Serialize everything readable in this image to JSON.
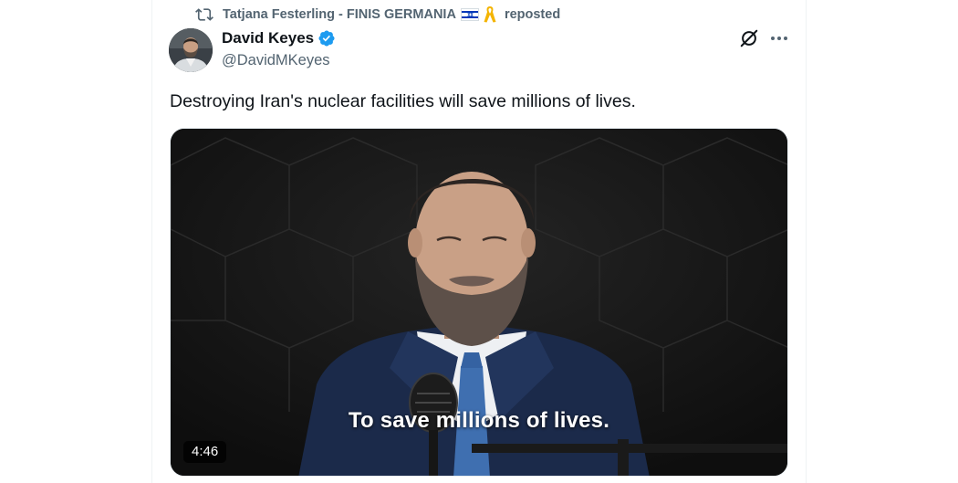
{
  "repost": {
    "reposter": "Tatjana Festerling - FINIS GERMANIA",
    "label": "reposted"
  },
  "author": {
    "name": "David Keyes",
    "handle": "@DavidMKeyes",
    "verified": true
  },
  "tweet": {
    "text": "Destroying Iran's nuclear facilities will save millions of lives."
  },
  "video": {
    "caption": "To save millions of lives.",
    "duration": "4:46"
  },
  "icons": {
    "repost": "repost-icon",
    "flag": "israel-flag-icon",
    "ribbon": "yellow-ribbon-icon",
    "verified": "verified-badge-icon",
    "grok": "grok-icon",
    "more": "more-options-icon"
  },
  "colors": {
    "accent": "#1d9bf0",
    "secondary_text": "#536471",
    "primary_text": "#0f1419",
    "ribbon": "#f4b400"
  }
}
